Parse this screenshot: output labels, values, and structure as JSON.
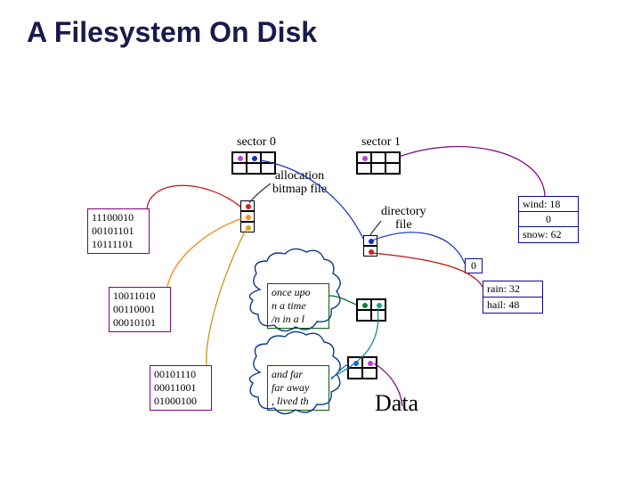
{
  "title": "A Filesystem On Disk",
  "labels": {
    "sector0": "sector 0",
    "sector1": "sector 1",
    "alloc_bitmap": "allocation\nbitmap file",
    "directory_file": "directory\nfile",
    "data": "Data"
  },
  "bitmaps": {
    "bm0": "11100010\n00101101\n10111101",
    "bm1": "10011010\n00110001\n00010101",
    "bm2": "00101110\n00011001\n01000100"
  },
  "stories": {
    "once": "once upo\nn a time\n/n in a l",
    "far": "and far \nfar away\n, lived th"
  },
  "dir_entries": {
    "zero_single": "0",
    "wind": "wind: 18",
    "zero_mid": "0",
    "snow": "snow: 62",
    "rain": "rain: 32",
    "hail": "hail: 48"
  }
}
